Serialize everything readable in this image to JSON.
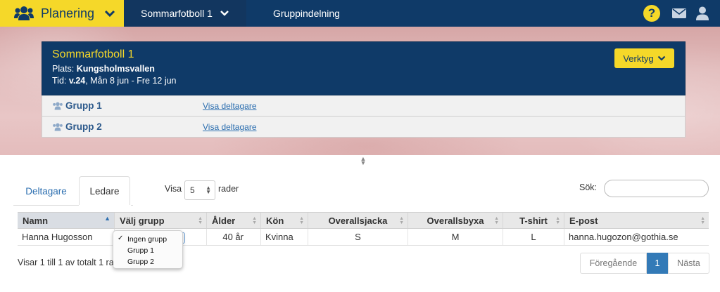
{
  "nav": {
    "brand_label": "Planering",
    "event_menu_label": "Sommarfotboll 1",
    "group_link_label": "Gruppindelning",
    "help_glyph": "?"
  },
  "event": {
    "title": "Sommarfotboll 1",
    "location_label": "Plats:",
    "location_value": "Kungsholmsvallen",
    "time_label": "Tid:",
    "time_week": "v.24",
    "time_range": ", Mån 8 jun - Fre 12 jun",
    "tools_label": "Verktyg",
    "groups": [
      {
        "name": "Grupp 1",
        "link": "Visa deltagare"
      },
      {
        "name": "Grupp 2",
        "link": "Visa deltagare"
      }
    ]
  },
  "tabs": {
    "participants": "Deltagare",
    "leaders": "Ledare"
  },
  "controls": {
    "show_label": "Visa",
    "rows_value": "5",
    "rows_label": "rader",
    "search_label": "Sök:",
    "search_value": ""
  },
  "table": {
    "headers": [
      "Namn",
      "Välj grupp",
      "Ålder",
      "Kön",
      "Overallsjacka",
      "Overallsbyxa",
      "T-shirt",
      "E-post"
    ],
    "rows": [
      {
        "name": "Hanna Hugosson",
        "age": "40 år",
        "gender": "Kvinna",
        "jacket": "S",
        "pants": "M",
        "tshirt": "L",
        "email": "hanna.hugozon@gothia.se"
      }
    ]
  },
  "dropdown": {
    "options": [
      "Ingen grupp",
      "Grupp 1",
      "Grupp 2"
    ],
    "selected_index": 0,
    "check_glyph": "✓"
  },
  "footer": {
    "info_text": "Visar 1 till 1 av totalt 1 rader",
    "prev_label": "Föregående",
    "page_label": "1",
    "next_label": "Nästa"
  },
  "colors": {
    "navy": "#0f3a68",
    "yellow": "#f5d829",
    "link_blue": "#2d6fb0",
    "active_page": "#337ab7"
  }
}
